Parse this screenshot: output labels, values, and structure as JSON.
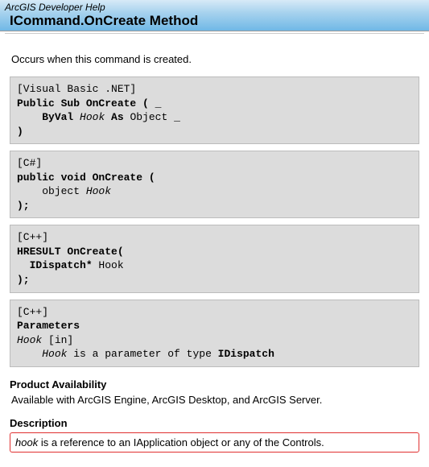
{
  "header": {
    "breadcrumb": "ArcGIS Developer Help",
    "title": "ICommand.OnCreate Method"
  },
  "summary": "Occurs when this command is created.",
  "code_blocks": {
    "vbnet": {
      "lang_tag": "[Visual Basic .NET]",
      "l1a": "Public Sub",
      "l1b": " OnCreate ",
      "l1c": "( _",
      "l2a": "    ",
      "l2b": "ByVal",
      "l2c": " Hook ",
      "l2d": "As",
      "l2e": " Object _",
      "l3": ")"
    },
    "csharp": {
      "lang_tag": "[C#]",
      "l1a": "public void",
      "l1b": " OnCreate ",
      "l1c": "(",
      "l2a": "    object ",
      "l2b": "Hook",
      "l3": ");"
    },
    "cpp1": {
      "lang_tag": "[C++]",
      "l1a": "HRESULT",
      "l1b": " OnCreate",
      "l1c": "(",
      "l2a": "  ",
      "l2b": "IDispatch*",
      "l2c": " Hook",
      "l3": ");"
    },
    "cpp2": {
      "lang_tag": "[C++]",
      "l1": "Parameters",
      "l2a": "Hook",
      "l2b": " [in]",
      "l3a": "    ",
      "l3b": "Hook",
      "l3c": " is a parameter of type ",
      "l3d": "IDispatch"
    }
  },
  "availability": {
    "heading": "Product Availability",
    "body": "Available with ArcGIS Engine, ArcGIS Desktop, and ArcGIS Server."
  },
  "description": {
    "heading": "Description",
    "hook_word": "hook",
    "body": " is a reference to an IApplication object or any of the Controls."
  }
}
